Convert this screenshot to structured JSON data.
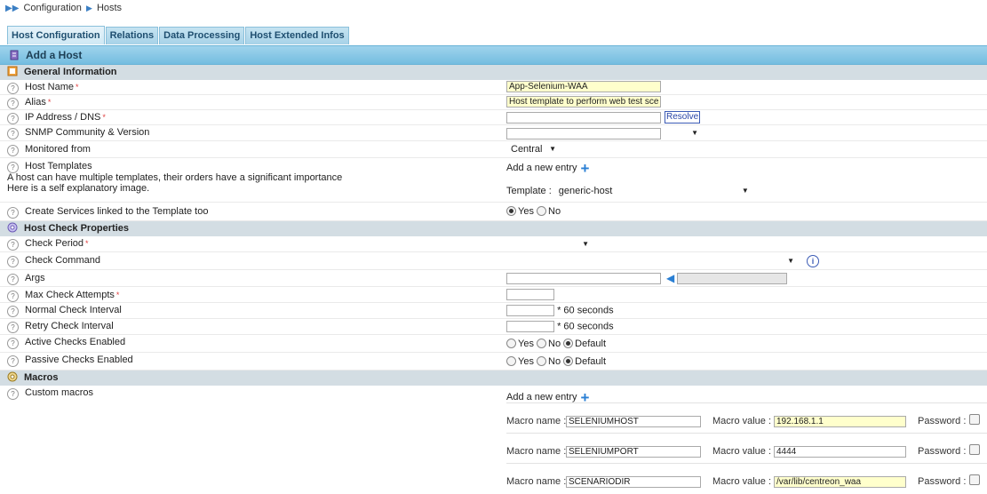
{
  "breadcrumb": {
    "root": "Configuration",
    "current": "Hosts"
  },
  "tabs": [
    "Host Configuration",
    "Relations",
    "Data Processing",
    "Host Extended Infos"
  ],
  "title": "Add a Host",
  "sections": {
    "general": "General Information",
    "check": "Host Check Properties",
    "macros": "Macros"
  },
  "general": {
    "host_name_label": "Host Name",
    "host_name_value": "App-Selenium-WAA",
    "alias_label": "Alias",
    "alias_value": "Host template to perform web test sce",
    "ip_label": "IP Address / DNS",
    "ip_value": "",
    "resolve_label": "Resolve",
    "snmp_label": "SNMP Community & Version",
    "snmp_value": "",
    "monitored_label": "Monitored from",
    "monitored_value": "Central",
    "templates_label": "Host Templates",
    "templates_help1": "A host can have multiple templates, their orders have a significant importance",
    "templates_help2": "Here is a self explanatory image.",
    "add_entry": "Add a new entry",
    "template_label": "Template :",
    "template_value": "generic-host",
    "create_services_label": "Create Services linked to the Template too",
    "yes": "Yes",
    "no": "No"
  },
  "check": {
    "period_label": "Check Period",
    "command_label": "Check Command",
    "args_label": "Args",
    "max_attempts_label": "Max Check Attempts",
    "normal_interval_label": "Normal Check Interval",
    "retry_interval_label": "Retry Check Interval",
    "seconds_suffix": "* 60 seconds",
    "active_label": "Active Checks Enabled",
    "passive_label": "Passive Checks Enabled",
    "yes": "Yes",
    "no": "No",
    "default": "Default"
  },
  "macros": {
    "custom_label": "Custom macros",
    "add_entry": "Add a new entry",
    "name_label": "Macro name :",
    "value_label": "Macro value :",
    "password_label": "Password :",
    "items": [
      {
        "name": "SELENIUMHOST",
        "value": "192.168.1.1"
      },
      {
        "name": "SELENIUMPORT",
        "value": "4444"
      },
      {
        "name": "SCENARIODIR",
        "value": "/var/lib/centreon_waa"
      }
    ]
  },
  "colors": {
    "accent": "#74bde0",
    "section": "#d3dde3",
    "highlight": "#ffffcc"
  }
}
